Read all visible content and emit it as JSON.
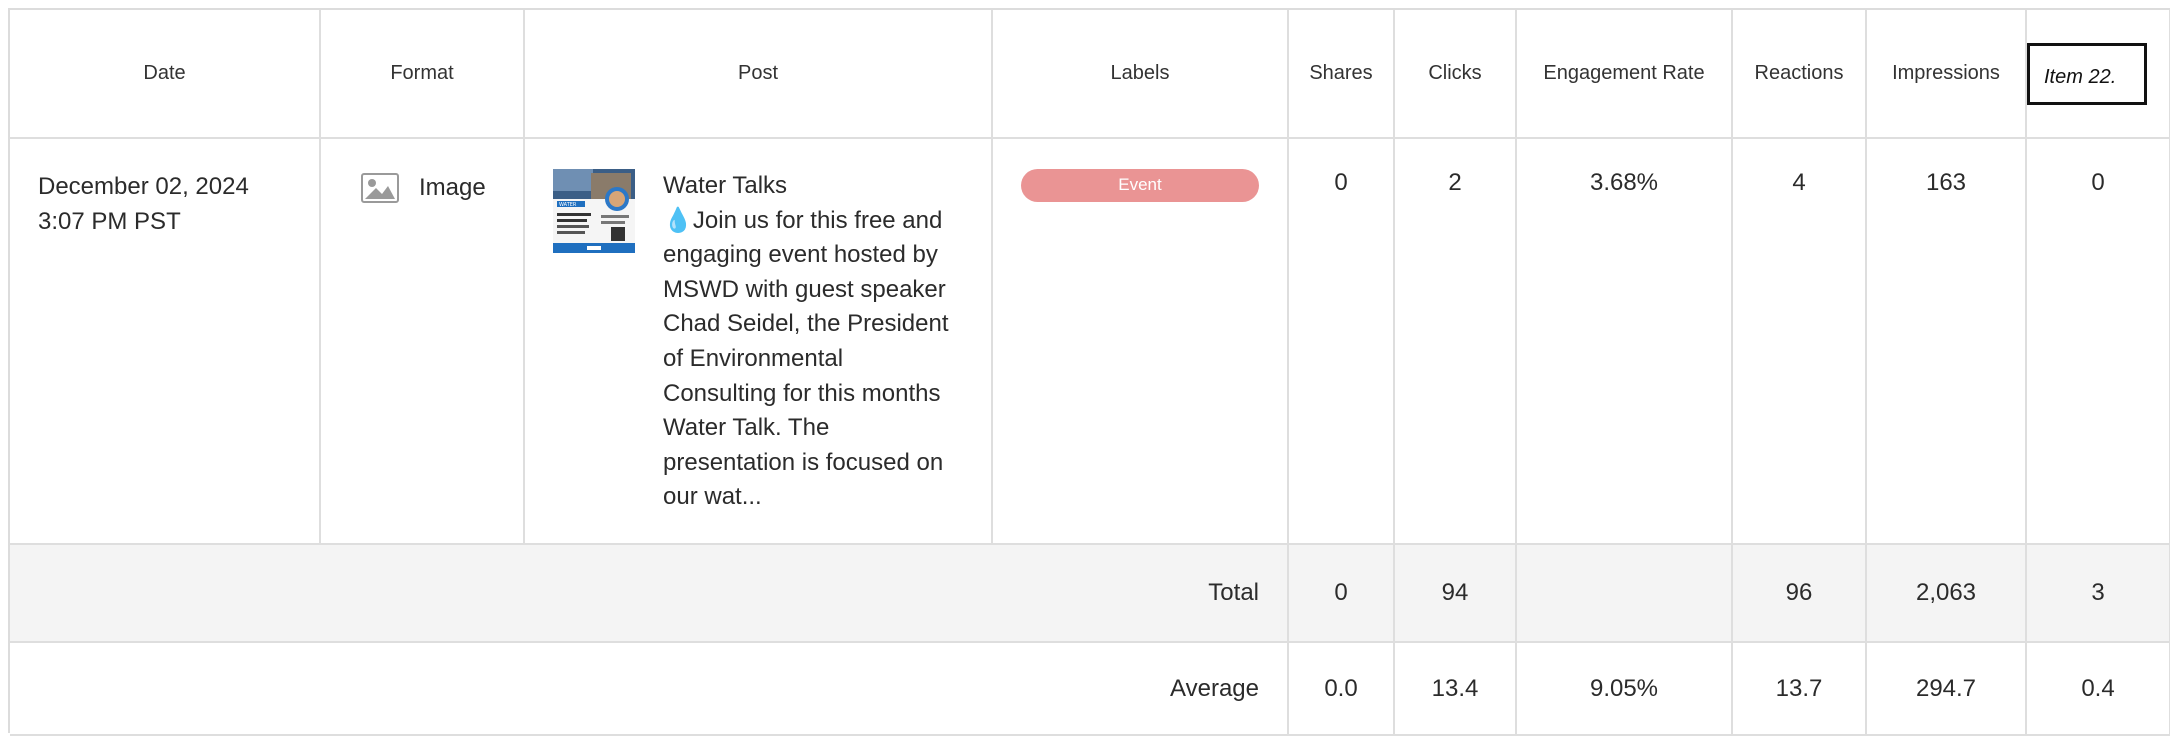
{
  "columns": {
    "date": "Date",
    "format": "Format",
    "post": "Post",
    "labels": "Labels",
    "shares": "Shares",
    "clicks": "Clicks",
    "engagement_rate": "Engagement Rate",
    "reactions": "Reactions",
    "impressions": "Impressions",
    "item": "Item 22."
  },
  "rows": [
    {
      "date": "December 02, 2024",
      "time": "3:07 PM PST",
      "format": "Image",
      "format_icon": "image-icon",
      "post_title": "Water Talks",
      "post_body": "💧Join us for this free and engaging event hosted by MSWD with guest speaker Chad Seidel, the President of Environmental Consulting for this months Water Talk. The presentation is focused on our wat...",
      "label": "Event",
      "label_color": "#ea9494",
      "shares": "0",
      "clicks": "2",
      "engagement_rate": "3.68%",
      "reactions": "4",
      "impressions": "163",
      "item": "0"
    }
  ],
  "total": {
    "label": "Total",
    "shares": "0",
    "clicks": "94",
    "engagement_rate": "",
    "reactions": "96",
    "impressions": "2,063",
    "item": "3"
  },
  "average": {
    "label": "Average",
    "shares": "0.0",
    "clicks": "13.4",
    "engagement_rate": "9.05%",
    "reactions": "13.7",
    "impressions": "294.7",
    "item": "0.4"
  }
}
